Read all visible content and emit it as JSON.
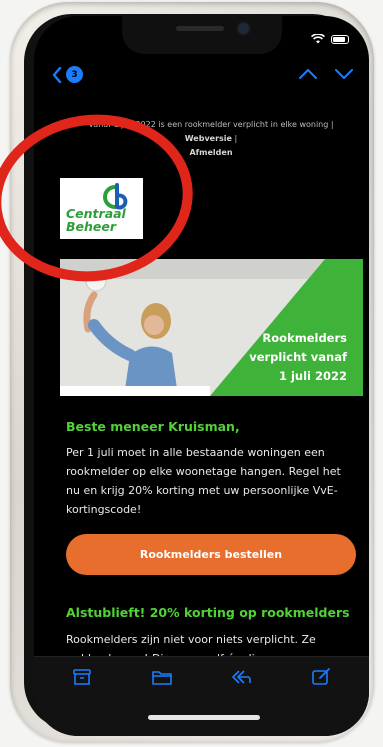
{
  "email": {
    "unread_count": "3",
    "preheader_text": "Vanaf 1 juli 2022 is een rookmelder verplicht in elke woning |",
    "preheader_link_web": "Webversie",
    "preheader_link_unsubscribe": "Afmelden",
    "logo": {
      "line1": "Centraal",
      "line2": "Beheer",
      "brand_color": "#2e9e3a"
    },
    "banner": {
      "line1": "Rookmelders",
      "line2": "verplicht vanaf",
      "line3": "1 juli 2022",
      "color": "#3fb23a"
    },
    "greeting": "Beste meneer Kruisman,",
    "intro": "Per 1 juli moet in alle bestaande woningen een rookmelder op elke woonetage hangen. Regel het nu en krijg 20% korting met uw persoonlijke VvE-kortingscode!",
    "cta_label": "Rookmelders bestellen",
    "cta_color": "#e86e2e",
    "subhead": "Alstublieft! 20% korting op rookmelders",
    "body2": "Rookmelders zijn niet voor niets verplicht. Ze redden levens! Die van uzelf én die van uw",
    "accent_green": "#52d236"
  },
  "toolbar": {
    "icons": [
      "archive-icon",
      "folder-icon",
      "reply-icon",
      "compose-icon"
    ]
  },
  "annotation": {
    "shape": "circle",
    "color": "#e0261b"
  }
}
